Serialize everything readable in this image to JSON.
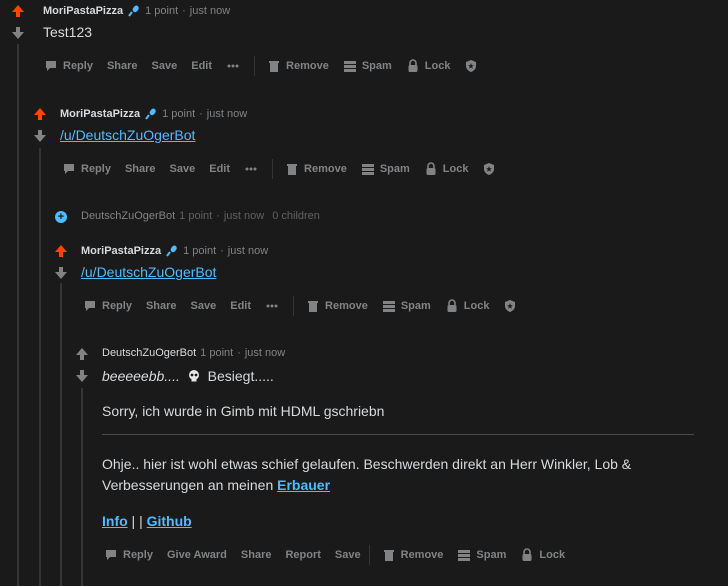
{
  "comments": [
    {
      "author": "MoriPastaPizza",
      "points": "1 point",
      "time": "just now",
      "body": "Test123",
      "actions": [
        "Reply",
        "Share",
        "Save",
        "Edit"
      ],
      "mod_actions": [
        "Remove",
        "Spam",
        "Lock"
      ]
    },
    {
      "author": "MoriPastaPizza",
      "points": "1 point",
      "time": "just now",
      "body_link": "/u/DeutschZuOgerBot",
      "actions": [
        "Reply",
        "Share",
        "Save",
        "Edit"
      ],
      "mod_actions": [
        "Remove",
        "Spam",
        "Lock"
      ]
    },
    {
      "author": "DeutschZuOgerBot",
      "points": "1 point",
      "time": "just now",
      "children": "0 children",
      "collapsed": true
    },
    {
      "author": "MoriPastaPizza",
      "points": "1 point",
      "time": "just now",
      "body_link": "/u/DeutschZuOgerBot",
      "actions": [
        "Reply",
        "Share",
        "Save",
        "Edit"
      ],
      "mod_actions": [
        "Remove",
        "Spam",
        "Lock"
      ]
    },
    {
      "author": "DeutschZuOgerBot",
      "points": "1 point",
      "time": "just now",
      "line1_italic": "beeeeebb....",
      "line1_rest": "Besiegt.....",
      "line2": "Sorry, ich wurde in Gimb mit HDML gschriebn",
      "line3a": "Ohje.. hier ist wohl etwas schief gelaufen. Beschwerden direkt an Herr Winkler, Lob &",
      "line3b": "Verbesserungen an meinen",
      "line3_link": "Erbauer",
      "info_link": "Info",
      "separator": "| |",
      "github_link": "Github",
      "actions": [
        "Reply",
        "Give Award",
        "Share",
        "Report",
        "Save"
      ],
      "mod_actions": [
        "Remove",
        "Spam",
        "Lock"
      ]
    }
  ],
  "colors": {
    "background": "#1a1a1b",
    "upvote": "#ff4500",
    "link": "#4fbcff",
    "muted": "#818384"
  },
  "icons": {
    "upvote": "arrow-up-icon",
    "downvote": "arrow-down-icon",
    "reply": "comment-icon",
    "more": "more-dots-icon",
    "remove": "trash-icon",
    "spam": "spam-icon",
    "lock": "lock-icon",
    "shield": "shield-icon",
    "mic": "microphone-icon",
    "skull": "skull-icon",
    "expand": "plus-circle-icon"
  }
}
